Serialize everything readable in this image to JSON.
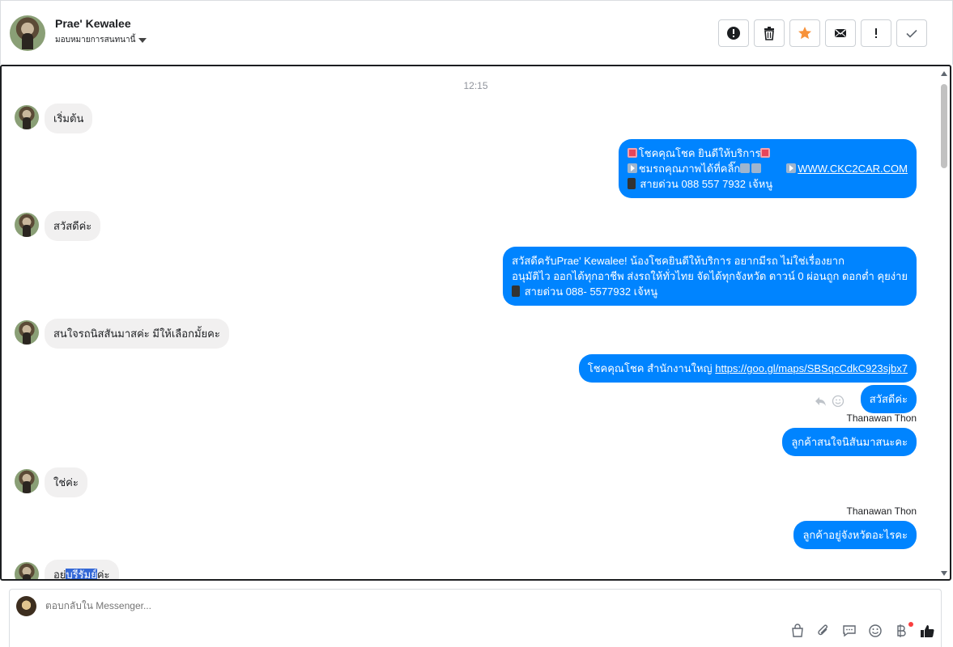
{
  "header": {
    "contact_name": "Prae' Kewalee",
    "assign_label": "มอบหมายการสนทนานี้",
    "actions": [
      {
        "name": "spam-button",
        "icon": "alert-circle-icon"
      },
      {
        "name": "delete-button",
        "icon": "trash-icon"
      },
      {
        "name": "star-button",
        "icon": "star-icon"
      },
      {
        "name": "mark-unread-button",
        "icon": "envelope-icon"
      },
      {
        "name": "important-button",
        "icon": "exclamation-icon"
      },
      {
        "name": "done-button",
        "icon": "check-icon"
      }
    ]
  },
  "conversation": {
    "timestamp": "12:15",
    "messages": [
      {
        "dir": "in",
        "text": "เริ่มต้น"
      },
      {
        "dir": "out",
        "lines": [
          "โชคคุณโชค ยินดีให้บริการ",
          "ชมรถคุณภาพได้ที่คลิ๊ก",
          "WWW.CKC2CAR.COM",
          "สายด่วน 088 557 7932 เจ้หนู"
        ]
      },
      {
        "dir": "in",
        "text": "สวัสดีค่ะ"
      },
      {
        "dir": "out",
        "lines": [
          "สวัสดีครับPrae' Kewalee! น้องโชคยินดีให้บริการ อยากมีรถ ไม่ใช่เรื่องยาก",
          "อนุมัติไว ออกได้ทุกอาชีพ ส่งรถให้ทั่วไทย จัดได้ทุกจังหวัด ดาวน์ 0  ผ่อนถูก ดอกต่ำ คุยง่าย",
          "สายด่วน 088- 5577932 เจ้หนู"
        ]
      },
      {
        "dir": "in",
        "text": "สนใจรถนิสสันมาสค่ะ มีให้เลือกมั้ยคะ"
      },
      {
        "dir": "out",
        "prefix": "โชคคุณโชค สำนักงานใหญ่ ",
        "link": "https://goo.gl/maps/SBSqcCdkC923sjbx7"
      },
      {
        "dir": "out",
        "text": "สวัสดีค่ะ"
      },
      {
        "dir": "out",
        "sender": "Thanawan Thon",
        "text": "ลูกค้าสนใจนิสันมาสนะคะ"
      },
      {
        "dir": "in",
        "text": "ใช่ค่ะ"
      },
      {
        "dir": "out",
        "sender": "Thanawan Thon",
        "text": "ลูกค้าอยู่จังหวัดอะไรคะ"
      },
      {
        "dir": "in",
        "text_a": "อยู่",
        "text_sel": "บุรีรัมย์",
        "text_b": "ค่ะ"
      }
    ]
  },
  "composer": {
    "placeholder": "ตอบกลับใน Messenger...",
    "tools": [
      "shop-bag-icon",
      "attachment-icon",
      "saved-reply-icon",
      "emoji-icon",
      "baht-icon",
      "thumbs-up-icon"
    ]
  },
  "colors": {
    "outgoing": "#0084ff",
    "incoming": "#f1f0f0",
    "star": "#f7923a"
  }
}
